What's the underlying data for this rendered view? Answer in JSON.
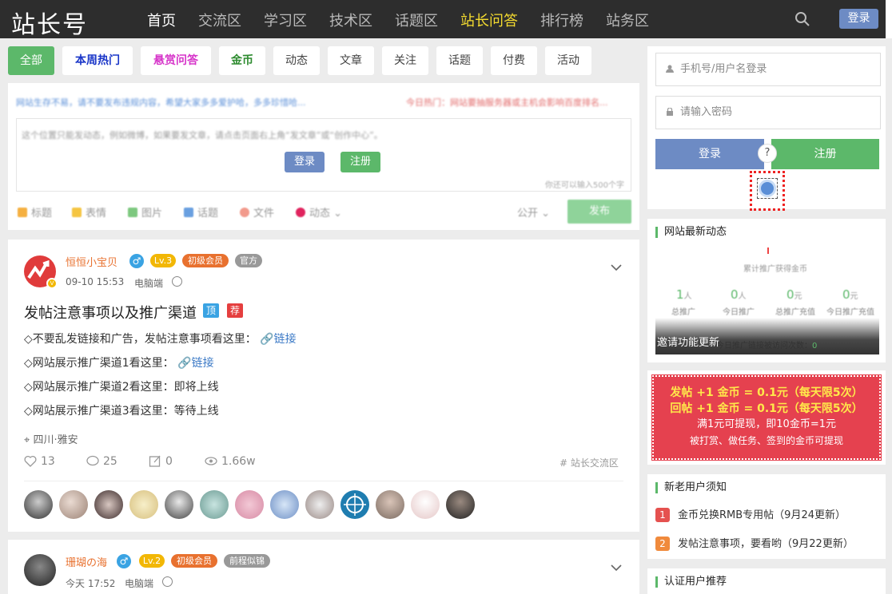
{
  "nav": {
    "logo": "站长号",
    "items": [
      "首页",
      "交流区",
      "学习区",
      "技术区",
      "话题区",
      "站长问答",
      "排行榜",
      "站务区"
    ],
    "login": "登录"
  },
  "tabs": [
    "全部",
    "本周热门",
    "悬赏问答",
    "金币",
    "动态",
    "文章",
    "关注",
    "话题",
    "付费",
    "活动"
  ],
  "publisher": {
    "notice": "网站生存不易，请不要发布违规内容，希望大家多多爱护哈，多多珍惜哈...",
    "hot": "今日热门：网站要抽服务器或主机会影响百度排名...",
    "placeholder": "这个位置只能发动态，例如微博，如果要发文章，请点击页面右上角“发文章”或“创作中心”。",
    "login": "登录",
    "register": "注册",
    "counter": "你还可以输入500个字",
    "tools": [
      "标题",
      "表情",
      "图片",
      "话题",
      "文件",
      "动态"
    ],
    "public": "公开",
    "send": "发布"
  },
  "post1": {
    "author": "恒恒小宝贝",
    "gender": "♂",
    "level": "Lv.3",
    "member": "初级会员",
    "role": "官方",
    "time": "09-10 15:53",
    "device": "电脑端",
    "title": "发帖注意事项以及推广渠道",
    "tag_top": "顶",
    "tag_rec": "荐",
    "lines": [
      {
        "text": "◇不要乱发链接和广告，发帖注意事项看这里：",
        "link": "链接"
      },
      {
        "text": "◇网站展示推广渠道1看这里：",
        "link": "链接"
      },
      {
        "text": "◇网站展示推广渠道2看这里：即将上线",
        "link": ""
      },
      {
        "text": "◇网站展示推广渠道3看这里：等待上线",
        "link": ""
      }
    ],
    "location": "四川·雅安",
    "likes": "13",
    "comments": "25",
    "shares": "0",
    "views": "1.66w",
    "topic": "# 站长交流区"
  },
  "post2": {
    "author": "珊瑚の海",
    "gender": "♂",
    "level": "Lv.2",
    "member": "初级会员",
    "role": "前程似锦",
    "time": "今天 17:52",
    "device": "电脑端"
  },
  "login_box": {
    "user_placeholder": "手机号/用户名登录",
    "pass_placeholder": "请输入密码",
    "login": "登录",
    "register": "注册",
    "help": "?"
  },
  "activity": {
    "title": "网站最新动态",
    "subtitle": "累计推广获得金币",
    "stats": [
      {
        "num": "1",
        "unit": "人",
        "label": "总推广"
      },
      {
        "num": "0",
        "unit": "人",
        "label": "今日推广"
      },
      {
        "num": "0",
        "unit": "元",
        "label": "总推广充值"
      },
      {
        "num": "0",
        "unit": "元",
        "label": "今日推广充值"
      }
    ],
    "footer": "邀请功能更新",
    "footer_small": "今日推广链接被访问次数：",
    "footer_count": "0"
  },
  "promo": {
    "line1": "发帖 +1 金币 = 0.1元（每天限5次）",
    "line2": "回帖 +1 金币 = 0.1元（每天限5次）",
    "line3": "满1元可提现，即10金币=1元",
    "line4": "被打赏、做任务、签到的金币可提现"
  },
  "notices": {
    "title": "新老用户须知",
    "items": [
      {
        "num": "1",
        "text": "金币兑换RMB专用帖（9月24更新）"
      },
      {
        "num": "2",
        "text": "发帖注意事项，要看哟（9月22更新）"
      }
    ]
  },
  "certified": {
    "title": "认证用户推荐"
  },
  "colors": {
    "accent_green": "#5cb86a",
    "accent_blue": "#6d8bc4",
    "nav_bg": "#2d2d2d",
    "promo_red": "#e5414f"
  }
}
